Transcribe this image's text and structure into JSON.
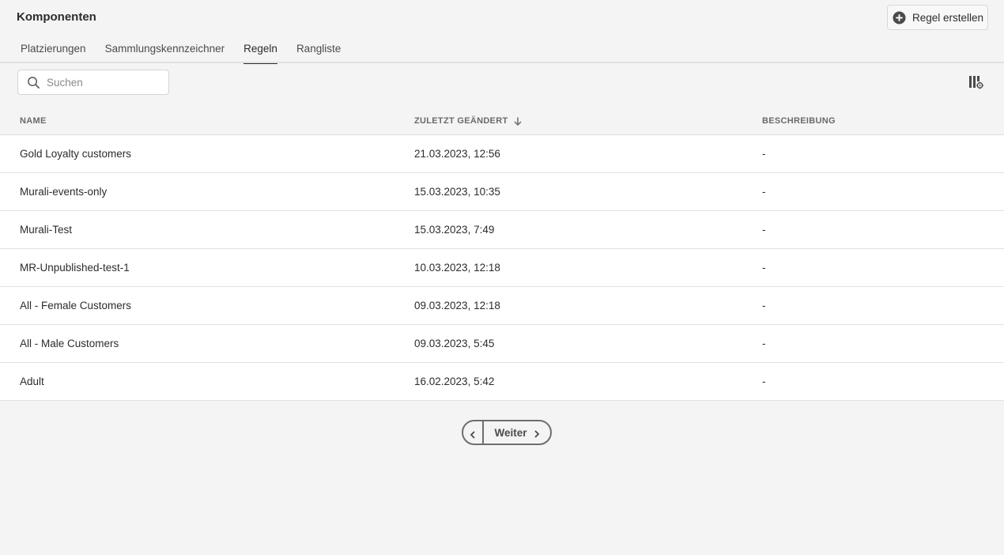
{
  "header": {
    "title": "Komponenten",
    "create_button_label": "Regel erstellen"
  },
  "tabs": [
    {
      "label": "Platzierungen",
      "active": false
    },
    {
      "label": "Sammlungskennzeichner",
      "active": false
    },
    {
      "label": "Regeln",
      "active": true
    },
    {
      "label": "Rangliste",
      "active": false
    }
  ],
  "search": {
    "placeholder": "Suchen",
    "value": ""
  },
  "table": {
    "columns": {
      "name": "NAME",
      "modified": "ZULETZT GEÄNDERT",
      "description": "BESCHREIBUNG"
    },
    "sort": {
      "column": "modified",
      "direction": "descending"
    },
    "rows": [
      {
        "name": "Gold Loyalty customers",
        "modified": "21.03.2023, 12:56",
        "description": "-"
      },
      {
        "name": "Murali-events-only",
        "modified": "15.03.2023, 10:35",
        "description": "-"
      },
      {
        "name": "Murali-Test",
        "modified": "15.03.2023, 7:49",
        "description": "-"
      },
      {
        "name": "MR-Unpublished-test-1",
        "modified": "10.03.2023, 12:18",
        "description": "-"
      },
      {
        "name": "All - Female Customers",
        "modified": "09.03.2023, 12:18",
        "description": "-"
      },
      {
        "name": "All - Male Customers",
        "modified": "09.03.2023, 5:45",
        "description": "-"
      },
      {
        "name": "Adult",
        "modified": "16.02.2023, 5:42",
        "description": "-"
      }
    ]
  },
  "pagination": {
    "next_label": "Weiter"
  },
  "icons": {
    "create": "plus-circle-icon",
    "search": "search-icon",
    "columns": "column-settings-icon",
    "sort": "arrow-down-icon",
    "prev": "chevron-left-icon",
    "next": "chevron-right-icon"
  }
}
